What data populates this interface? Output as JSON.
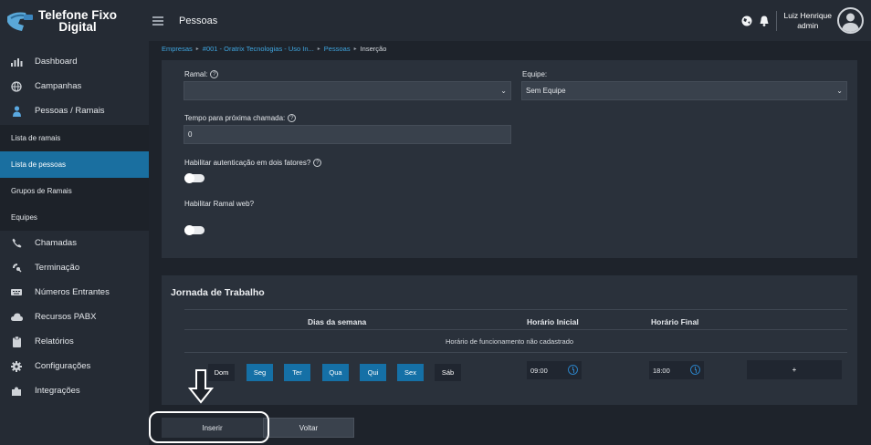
{
  "app": {
    "title_line1": "Telefone Fixo",
    "title_line2": "Digital"
  },
  "header": {
    "title": "Pessoas",
    "user_name": "Luiz Henrique",
    "user_role": "admin"
  },
  "breadcrumb": {
    "items": [
      "Empresas",
      "#001 - Oratrix Tecnologias - Uso In...",
      "Pessoas"
    ],
    "current": "Inserção"
  },
  "sidebar": {
    "items": [
      {
        "label": "Dashboard",
        "icon": "bar-chart-icon"
      },
      {
        "label": "Campanhas",
        "icon": "globe-icon"
      },
      {
        "label": "Pessoas / Ramais",
        "icon": "person-icon"
      },
      {
        "label": "Chamadas",
        "icon": "phone-icon"
      },
      {
        "label": "Terminação",
        "icon": "satellite-icon"
      },
      {
        "label": "Números Entrantes",
        "icon": "keypad-icon"
      },
      {
        "label": "Recursos PABX",
        "icon": "cloud-icon"
      },
      {
        "label": "Relatórios",
        "icon": "clipboard-icon"
      },
      {
        "label": "Configurações",
        "icon": "gear-icon"
      },
      {
        "label": "Integrações",
        "icon": "puzzle-icon"
      }
    ],
    "subitems": [
      "Lista de ramais",
      "Lista de pessoas",
      "Grupos de Ramais",
      "Equipes"
    ]
  },
  "form": {
    "ramal_label": "Ramal:",
    "ramal_value": "",
    "equipe_label": "Equipe:",
    "equipe_value": "Sem Equipe",
    "tempo_label": "Tempo para próxima chamada:",
    "tempo_value": "0",
    "dois_fatores_label": "Habilitar autenticação em dois fatores?",
    "ramal_web_label": "Habilitar Ramal web?"
  },
  "jornada": {
    "title": "Jornada de Trabalho",
    "col_days": "Dias da semana",
    "col_start": "Horário Inicial",
    "col_end": "Horário Final",
    "empty": "Horário de funcionamento não cadastrado",
    "days": [
      {
        "label": "Dom",
        "active": false
      },
      {
        "label": "Seg",
        "active": true
      },
      {
        "label": "Ter",
        "active": true
      },
      {
        "label": "Qua",
        "active": true
      },
      {
        "label": "Qui",
        "active": true
      },
      {
        "label": "Sex",
        "active": true
      },
      {
        "label": "Sáb",
        "active": false
      }
    ],
    "start_time": "09:00",
    "end_time": "18:00",
    "add_label": "+"
  },
  "actions": {
    "insert": "Inserir",
    "back": "Voltar"
  },
  "colors": {
    "accent": "#1570a6",
    "link": "#3fa6e0",
    "sidebar": "#252b34",
    "panel": "#2a313b"
  }
}
